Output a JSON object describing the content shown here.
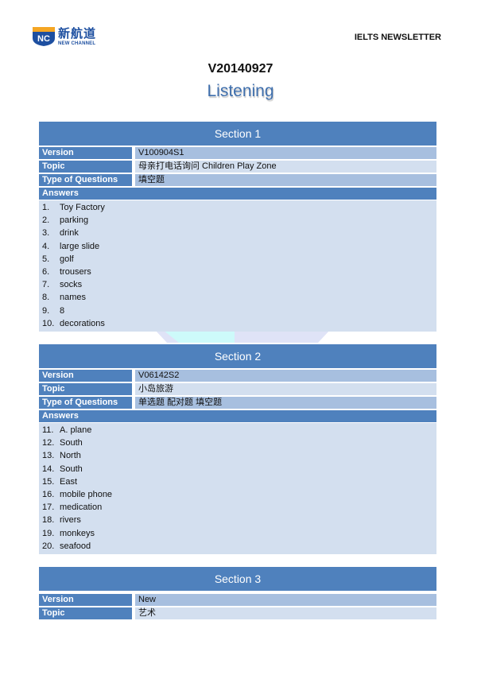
{
  "header": {
    "logo": {
      "badge": "NC",
      "name_cn": "新航道",
      "name_en": "NEW CHANNEL",
      "colors": {
        "blue": "#1d4fa0",
        "orange": "#f5a623"
      }
    },
    "newsletter_label": "IELTS NEWSLETTER"
  },
  "document": {
    "title": "V20140927",
    "subtitle": "Listening"
  },
  "colors": {
    "header_blue": "#4f81bd",
    "value_dark": "#a7bfdf",
    "value_light": "#d3dfef"
  },
  "sections": [
    {
      "title": "Section 1",
      "rows": [
        {
          "label": "Version",
          "value": "V100904S1"
        },
        {
          "label": "Topic",
          "value": "母亲打电话询问  Children Play Zone"
        },
        {
          "label": "Type of Questions",
          "value": "填空题"
        }
      ],
      "answers_label": "Answers",
      "answers": [
        {
          "num": "1.",
          "text": "Toy Factory"
        },
        {
          "num": "2.",
          "text": "parking"
        },
        {
          "num": "3.",
          "text": "drink"
        },
        {
          "num": "4.",
          "text": "large slide"
        },
        {
          "num": "5.",
          "text": "golf"
        },
        {
          "num": "6.",
          "text": "trousers"
        },
        {
          "num": "7.",
          "text": "socks"
        },
        {
          "num": "8.",
          "text": "names"
        },
        {
          "num": "9.",
          "text": "8"
        },
        {
          "num": "10.",
          "text": "decorations"
        }
      ]
    },
    {
      "title": "Section 2",
      "rows": [
        {
          "label": "Version",
          "value": "V06142S2"
        },
        {
          "label": "Topic",
          "value": "小岛旅游"
        },
        {
          "label": "Type of Questions",
          "value": "单选题  配对题  填空题"
        }
      ],
      "answers_label": "Answers",
      "answers": [
        {
          "num": "11.",
          "text": "A. plane"
        },
        {
          "num": "12.",
          "text": "South"
        },
        {
          "num": "13.",
          "text": "North"
        },
        {
          "num": "14.",
          "text": "South"
        },
        {
          "num": "15.",
          "text": "East"
        },
        {
          "num": "16.",
          "text": "mobile phone"
        },
        {
          "num": "17.",
          "text": "medication"
        },
        {
          "num": "18.",
          "text": "rivers"
        },
        {
          "num": "19.",
          "text": "monkeys"
        },
        {
          "num": "20.",
          "text": "seafood"
        }
      ]
    },
    {
      "title": "Section 3",
      "rows": [
        {
          "label": "Version",
          "value": "New"
        },
        {
          "label": "Topic",
          "value": "艺术"
        }
      ]
    }
  ]
}
